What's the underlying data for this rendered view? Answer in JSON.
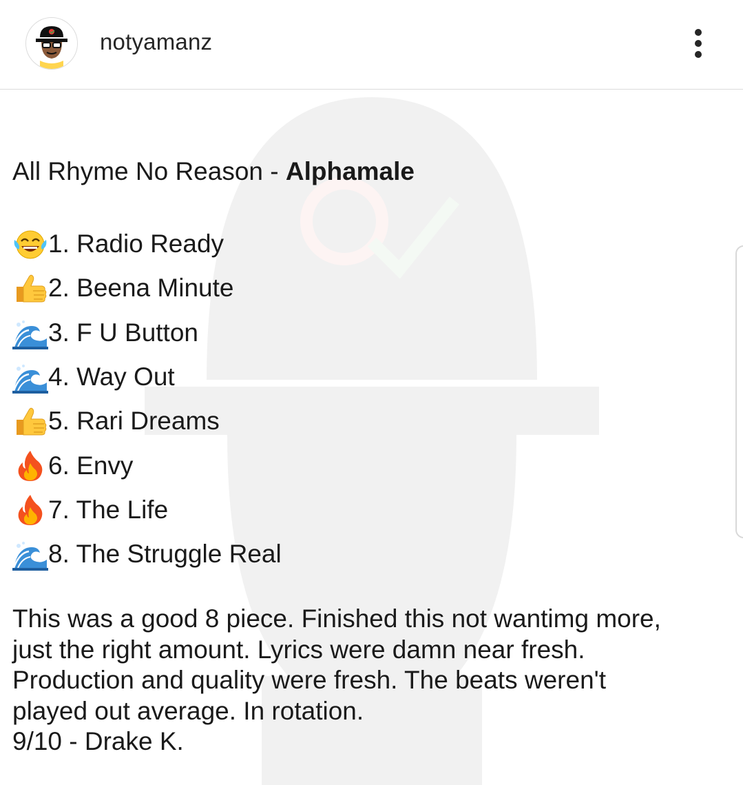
{
  "header": {
    "username": "notyamanz",
    "avatar_icon": "cartoon-bucket-hat-avatar-icon",
    "more_icon": "more-options-icon"
  },
  "post": {
    "title_plain": "All Rhyme No Reason - ",
    "title_bold": "Alphamale",
    "tracks": [
      {
        "emoji": "laughing-crying-icon",
        "text": "1. Radio Ready"
      },
      {
        "emoji": "thumbs-up-icon",
        "text": "2. Beena Minute"
      },
      {
        "emoji": "wave-icon",
        "text": "3. F U Button"
      },
      {
        "emoji": "wave-icon",
        "text": "4. Way Out"
      },
      {
        "emoji": "thumbs-up-icon",
        "text": "5. Rari Dreams"
      },
      {
        "emoji": "fire-icon",
        "text": "6. Envy"
      },
      {
        "emoji": "fire-icon",
        "text": "7. The Life"
      },
      {
        "emoji": "wave-icon",
        "text": "8. The Struggle Real"
      }
    ],
    "review_lines": [
      "This was a good 8 piece. Finished this not wantimg more,",
      "just the right amount. Lyrics were damn near fresh.",
      "Production and quality were fresh. The beats weren't",
      "played out average. In rotation.",
      "9/10 - Drake K."
    ]
  },
  "colors": {
    "text": "#1a1a1a",
    "divider": "#dbdbdb",
    "accent_red": "#e53935",
    "accent_green": "#43a047"
  }
}
